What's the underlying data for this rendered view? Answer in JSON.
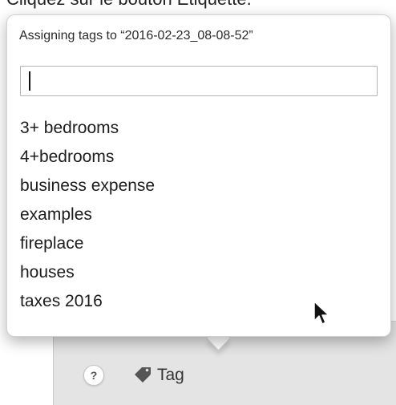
{
  "header_fragment": "Cliquez sur le bouton Étiquette.",
  "popover": {
    "title": "Assigning tags to “2016-02-23_08-08-52”",
    "input_value": "",
    "tags": [
      "3+ bedrooms",
      "4+bedrooms",
      "business expense",
      "examples",
      "fireplace",
      "houses",
      "taxes 2016"
    ]
  },
  "toolbar": {
    "help_label": "?",
    "tag_label": "Tag",
    "help_icon": "question-circle-icon",
    "tag_icon": "tag-icon"
  },
  "colors": {
    "panel_background": "#e4e4e4",
    "popover_background": "#ffffff",
    "text": "#1c1c1c"
  }
}
